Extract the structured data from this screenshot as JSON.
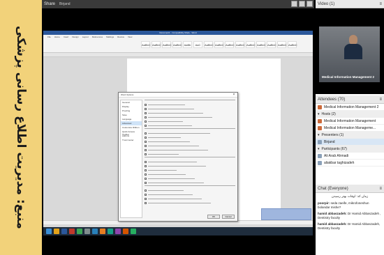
{
  "sidebar_title": "منبع: مدیریت اطلاع رسانی پزشکی",
  "share": {
    "title": "Share",
    "presenter": "Birjand"
  },
  "word": {
    "window_title": "Document1 - Compatibility Mode - Word",
    "tabs": [
      "File",
      "Home",
      "Insert",
      "Design",
      "Layout",
      "References",
      "Mailings",
      "Review",
      "View"
    ],
    "styles": [
      "AaBbC",
      "AaBbC",
      "AaBbC",
      "AaBbC",
      "AaBb",
      "AaC",
      "AaBbC",
      "AaBbC",
      "AaBbC",
      "AaBbC",
      "AaBbC",
      "AaBbC",
      "AaBbC",
      "AaBbC",
      "AaBbC"
    ]
  },
  "dialog": {
    "title": "Word Options",
    "close": "×",
    "nav": [
      "General",
      "Display",
      "Proofing",
      "Save",
      "Language",
      "Advanced",
      "Customize Ribbon",
      "Quick Access Toolbar",
      "Add-ins",
      "Trust Center"
    ],
    "active_index": 5,
    "ok": "OK",
    "cancel": "Cancel"
  },
  "video": {
    "header": "Video",
    "count": "(1)",
    "caption": "Medical Information Management 2"
  },
  "attendees": {
    "header": "Attendees",
    "count": "(70)",
    "meeting": "Medical Information Management 2",
    "hosts_label": "Hosts (2)",
    "hosts": [
      "Medical Information Management",
      "Medical Information Manageme..."
    ],
    "presenters_label": "Presenters (1)",
    "presenters": [
      "Birjand"
    ],
    "participants_label": "Participants (67)",
    "participants": [
      "Ali Arab Ahmadi",
      "aliakbar taghizadeh"
    ]
  },
  "chat": {
    "header": "Chat",
    "scope": "(Everyone)",
    "messages": [
      {
        "name": "",
        "text": "زمان کد: اوقات بهتر رسیدن"
      },
      {
        "name": "poorpir:",
        "text": "seda zaeife, mikrofoneshun bolandar mishe?"
      },
      {
        "name": "hamid abbaszadeh:",
        "text": "Dr Hamid Abbaszadeh , Dentistry faculty"
      },
      {
        "name": "hamid abbaszadeh:",
        "text": "Dr Hamid Abbaszadeh, Dentistry faculty"
      }
    ]
  },
  "colors": {
    "stripe": "#f2d27a",
    "word_blue": "#2b579a",
    "host_icon": "#cc6a3a"
  }
}
